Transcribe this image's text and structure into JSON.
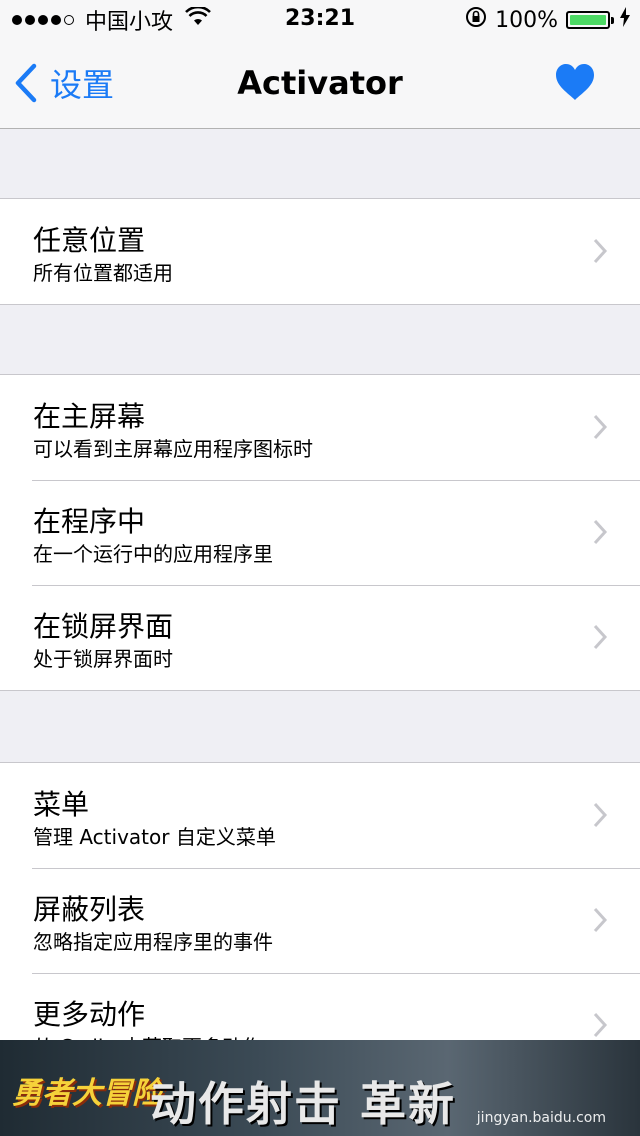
{
  "status_bar": {
    "carrier": "中国小攻",
    "time": "23:21",
    "battery_percent": "100%",
    "battery_level": 1.0,
    "signal_dots_filled": 4,
    "signal_dots_total": 5
  },
  "nav": {
    "back_label": "设置",
    "title": "Activator",
    "accent_color": "#1b7bf6",
    "heart_icon": "heart-icon"
  },
  "groups": [
    {
      "items": [
        {
          "title": "任意位置",
          "subtitle": "所有位置都适用"
        }
      ]
    },
    {
      "items": [
        {
          "title": "在主屏幕",
          "subtitle": "可以看到主屏幕应用程序图标时"
        },
        {
          "title": "在程序中",
          "subtitle": "在一个运行中的应用程序里"
        },
        {
          "title": "在锁屏界面",
          "subtitle": "处于锁屏界面时"
        }
      ]
    },
    {
      "items": [
        {
          "title": "菜单",
          "subtitle": "管理 Activator 自定义菜单"
        },
        {
          "title": "屏蔽列表",
          "subtitle": "忽略指定应用程序里的事件"
        },
        {
          "title": "更多动作",
          "subtitle": "从 Cydia 中获取更多动作"
        }
      ]
    }
  ],
  "ad_banner": {
    "logo_text": "勇者大冒险",
    "slogan": "动作射击 革新",
    "watermark": "jingyan.baidu.com"
  }
}
